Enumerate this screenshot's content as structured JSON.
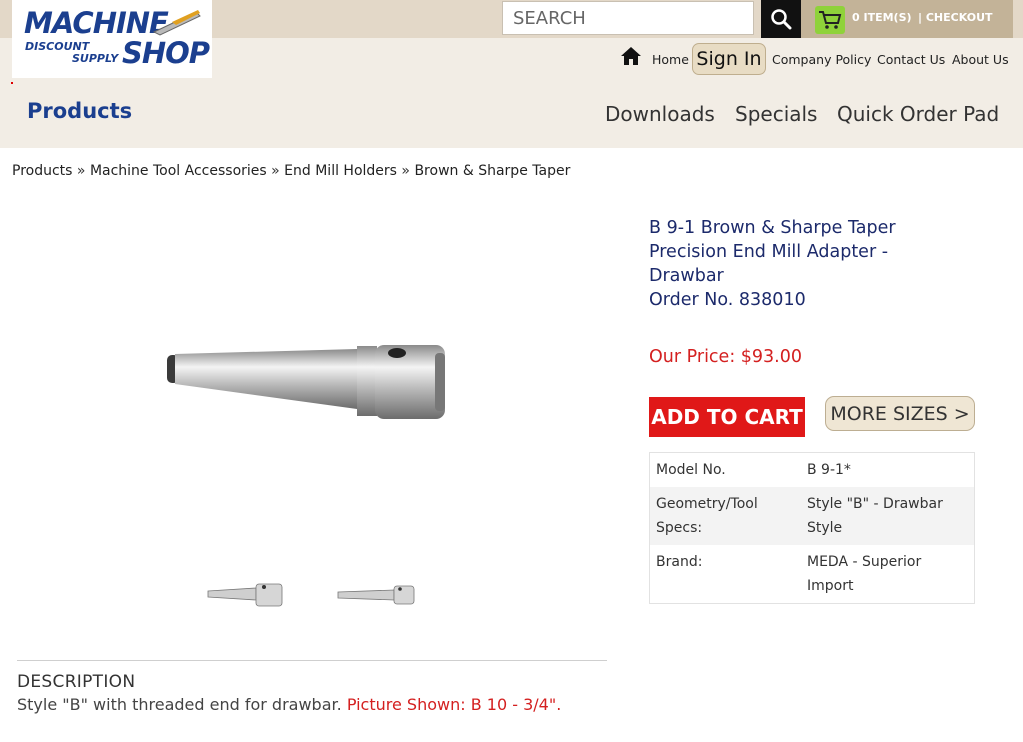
{
  "logo": {
    "line1": "MACHINE",
    "line2a": "DISCOUNT",
    "line2b": "SUPPLY",
    "line3": "SHOP"
  },
  "search": {
    "placeholder": "SEARCH"
  },
  "cart": {
    "items": "0 ITEM(S)",
    "checkout": "| CHECKOUT"
  },
  "top_nav": {
    "home": "Home",
    "sign_in": "Sign In",
    "company_policy": "Company Policy",
    "contact_us": "Contact Us",
    "about_us": "About Us"
  },
  "main_nav": {
    "products": "Products",
    "downloads": "Downloads",
    "specials": "Specials",
    "quick_order": "Quick Order Pad"
  },
  "breadcrumb": [
    "Products",
    "Machine Tool Accessories",
    "End Mill Holders",
    "Brown & Sharpe Taper"
  ],
  "breadcrumb_sep": "»",
  "product": {
    "title_line1": "B 9-1 Brown & Sharpe Taper",
    "title_line2": "Precision End Mill Adapter -",
    "title_line3": "Drawbar",
    "order_no": "Order No. 838010",
    "price": "Our Price: $93.00",
    "add_to_cart": "ADD TO CART",
    "more_sizes": "MORE SIZES >"
  },
  "specs": [
    {
      "key": "Model No.",
      "value": "B 9-1*"
    },
    {
      "key": "Geometry/Tool Specs:",
      "value": "Style \"B\" - Drawbar Style"
    },
    {
      "key": "Brand:",
      "value": "MEDA - Superior Import"
    }
  ],
  "description": {
    "heading": "DESCRIPTION",
    "text": "Style \"B\" with threaded end for drawbar.",
    "picture_note": "Picture Shown: B 10 - 3/4\"."
  },
  "colors": {
    "brand_blue": "#1b3f8f",
    "price_red": "#d42020",
    "cart_green": "#8fd23a"
  },
  "icons": [
    "search-icon",
    "cart-icon",
    "home-icon"
  ]
}
